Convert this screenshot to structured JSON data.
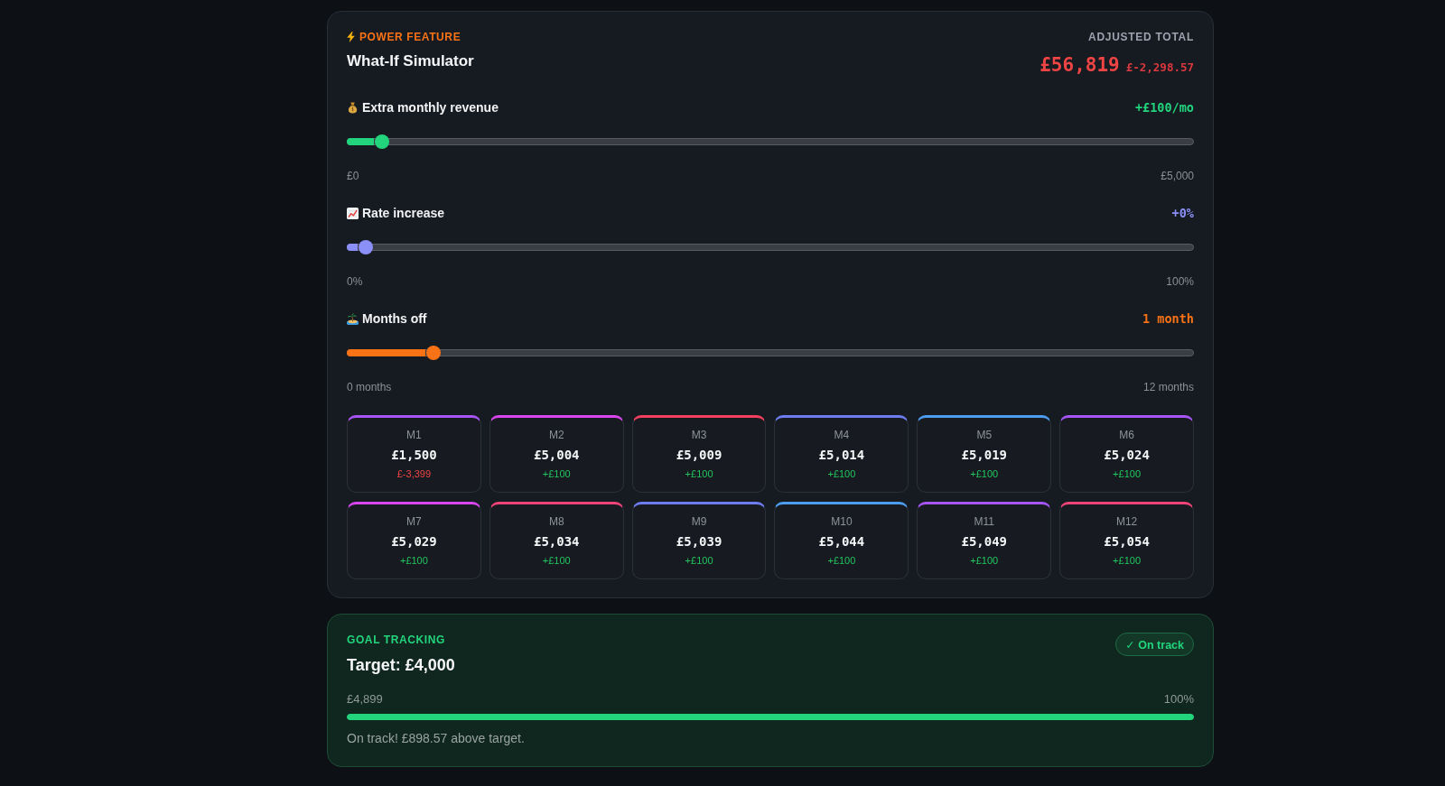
{
  "simulator": {
    "eyebrow": "POWER FEATURE",
    "title": "What-If Simulator",
    "total_label": "ADJUSTED TOTAL",
    "total_value": "£56,819",
    "total_change": "£-2,298.57"
  },
  "sliders": [
    {
      "label": "Extra monthly revenue",
      "reading": "+£100/mo",
      "level": 0.02,
      "color": "#22d47c",
      "min_label": "£0",
      "max_label": "£5,000"
    },
    {
      "label": "Rate increase",
      "reading": "+0%",
      "level": 0,
      "color": "#8b8ff8",
      "min_label": "0%",
      "max_label": "100%"
    },
    {
      "label": "Months off",
      "reading": "1 month",
      "level": 0.0833,
      "color": "#f97316",
      "min_label": "0 months",
      "max_label": "12 months"
    }
  ],
  "months": [
    {
      "label": "M1",
      "value": "£1,500",
      "change": "£-3,399",
      "negative": true,
      "color": "#a855f7"
    },
    {
      "label": "M2",
      "value": "£5,004",
      "change": "+£100",
      "negative": false,
      "color": "#d946ef"
    },
    {
      "label": "M3",
      "value": "£5,009",
      "change": "+£100",
      "negative": false,
      "color": "#f43f5e"
    },
    {
      "label": "M4",
      "value": "£5,014",
      "change": "+£100",
      "negative": false,
      "color": "#6d7cf0"
    },
    {
      "label": "M5",
      "value": "£5,019",
      "change": "+£100",
      "negative": false,
      "color": "#4c9df0"
    },
    {
      "label": "M6",
      "value": "£5,024",
      "change": "+£100",
      "negative": false,
      "color": "#a855f7"
    },
    {
      "label": "M7",
      "value": "£5,029",
      "change": "+£100",
      "negative": false,
      "color": "#d946ef"
    },
    {
      "label": "M8",
      "value": "£5,034",
      "change": "+£100",
      "negative": false,
      "color": "#ef4477"
    },
    {
      "label": "M9",
      "value": "£5,039",
      "change": "+£100",
      "negative": false,
      "color": "#6d7cf0"
    },
    {
      "label": "M10",
      "value": "£5,044",
      "change": "+£100",
      "negative": false,
      "color": "#4c9df0"
    },
    {
      "label": "M11",
      "value": "£5,049",
      "change": "+£100",
      "negative": false,
      "color": "#a855f7"
    },
    {
      "label": "M12",
      "value": "£5,054",
      "change": "+£100",
      "negative": false,
      "color": "#ef4477"
    }
  ],
  "goal": {
    "eyebrow": "GOAL TRACKING",
    "title": "Target: £4,000",
    "badge": "✓ On track",
    "current": "£4,899",
    "percent": "100%",
    "level": 1,
    "message": "On track! £898.57 above target."
  }
}
